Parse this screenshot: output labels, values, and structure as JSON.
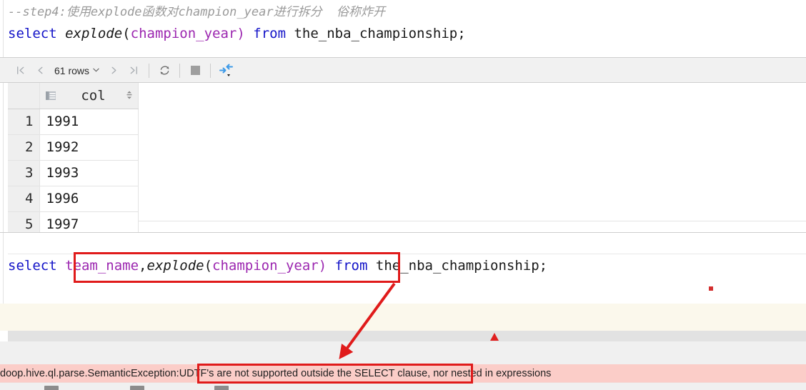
{
  "editor_top": {
    "comment": "--step4:使用explode函数对champion_year进行拆分  俗称炸开",
    "sql": {
      "kw_select": "select",
      "fn_explode": "explode",
      "paren_open": "(",
      "column": "champion_year",
      "paren_close": ")",
      "kw_from": "from",
      "table": "the_nba_championship;"
    }
  },
  "result_toolbar": {
    "first_page_label": "|<",
    "prev_page_label": "<",
    "rows_label": "61 rows",
    "rows_chevron": "⌄",
    "next_page_label": ">",
    "last_page_label": ">|",
    "refresh_label": "refresh",
    "stop_label": "stop",
    "transpose_label": "transpose"
  },
  "result_grid": {
    "column_header": "col",
    "rows": [
      {
        "num": "1",
        "col": "1991"
      },
      {
        "num": "2",
        "col": "1992"
      },
      {
        "num": "3",
        "col": "1993"
      },
      {
        "num": "4",
        "col": "1996"
      },
      {
        "num": "5",
        "col": "1997"
      }
    ]
  },
  "editor_bottom": {
    "sql": {
      "kw_select": "select",
      "column_team": "team_name",
      "comma": ",",
      "fn_explode": "explode",
      "paren_open": "(",
      "column_year": "champion_year",
      "paren_close": ")",
      "kw_from": "from",
      "table": "the_nba_championship;"
    }
  },
  "error": {
    "prefix": "doop.hive.ql.parse.SemanticException:",
    "highlighted": "UDTF's are not supported outside the SELECT clause,",
    "suffix": " nor nested in expressions"
  },
  "colors": {
    "keyword": "#1414c8",
    "identifier": "#9c27b0",
    "comment": "#9a9a9a",
    "annotation_red": "#e01b1b",
    "error_bg": "#fbcdc8",
    "toolbar_bg": "#f1f1f1",
    "cream_band": "#fbf8ec",
    "accent_blue": "#3d9ae8"
  }
}
